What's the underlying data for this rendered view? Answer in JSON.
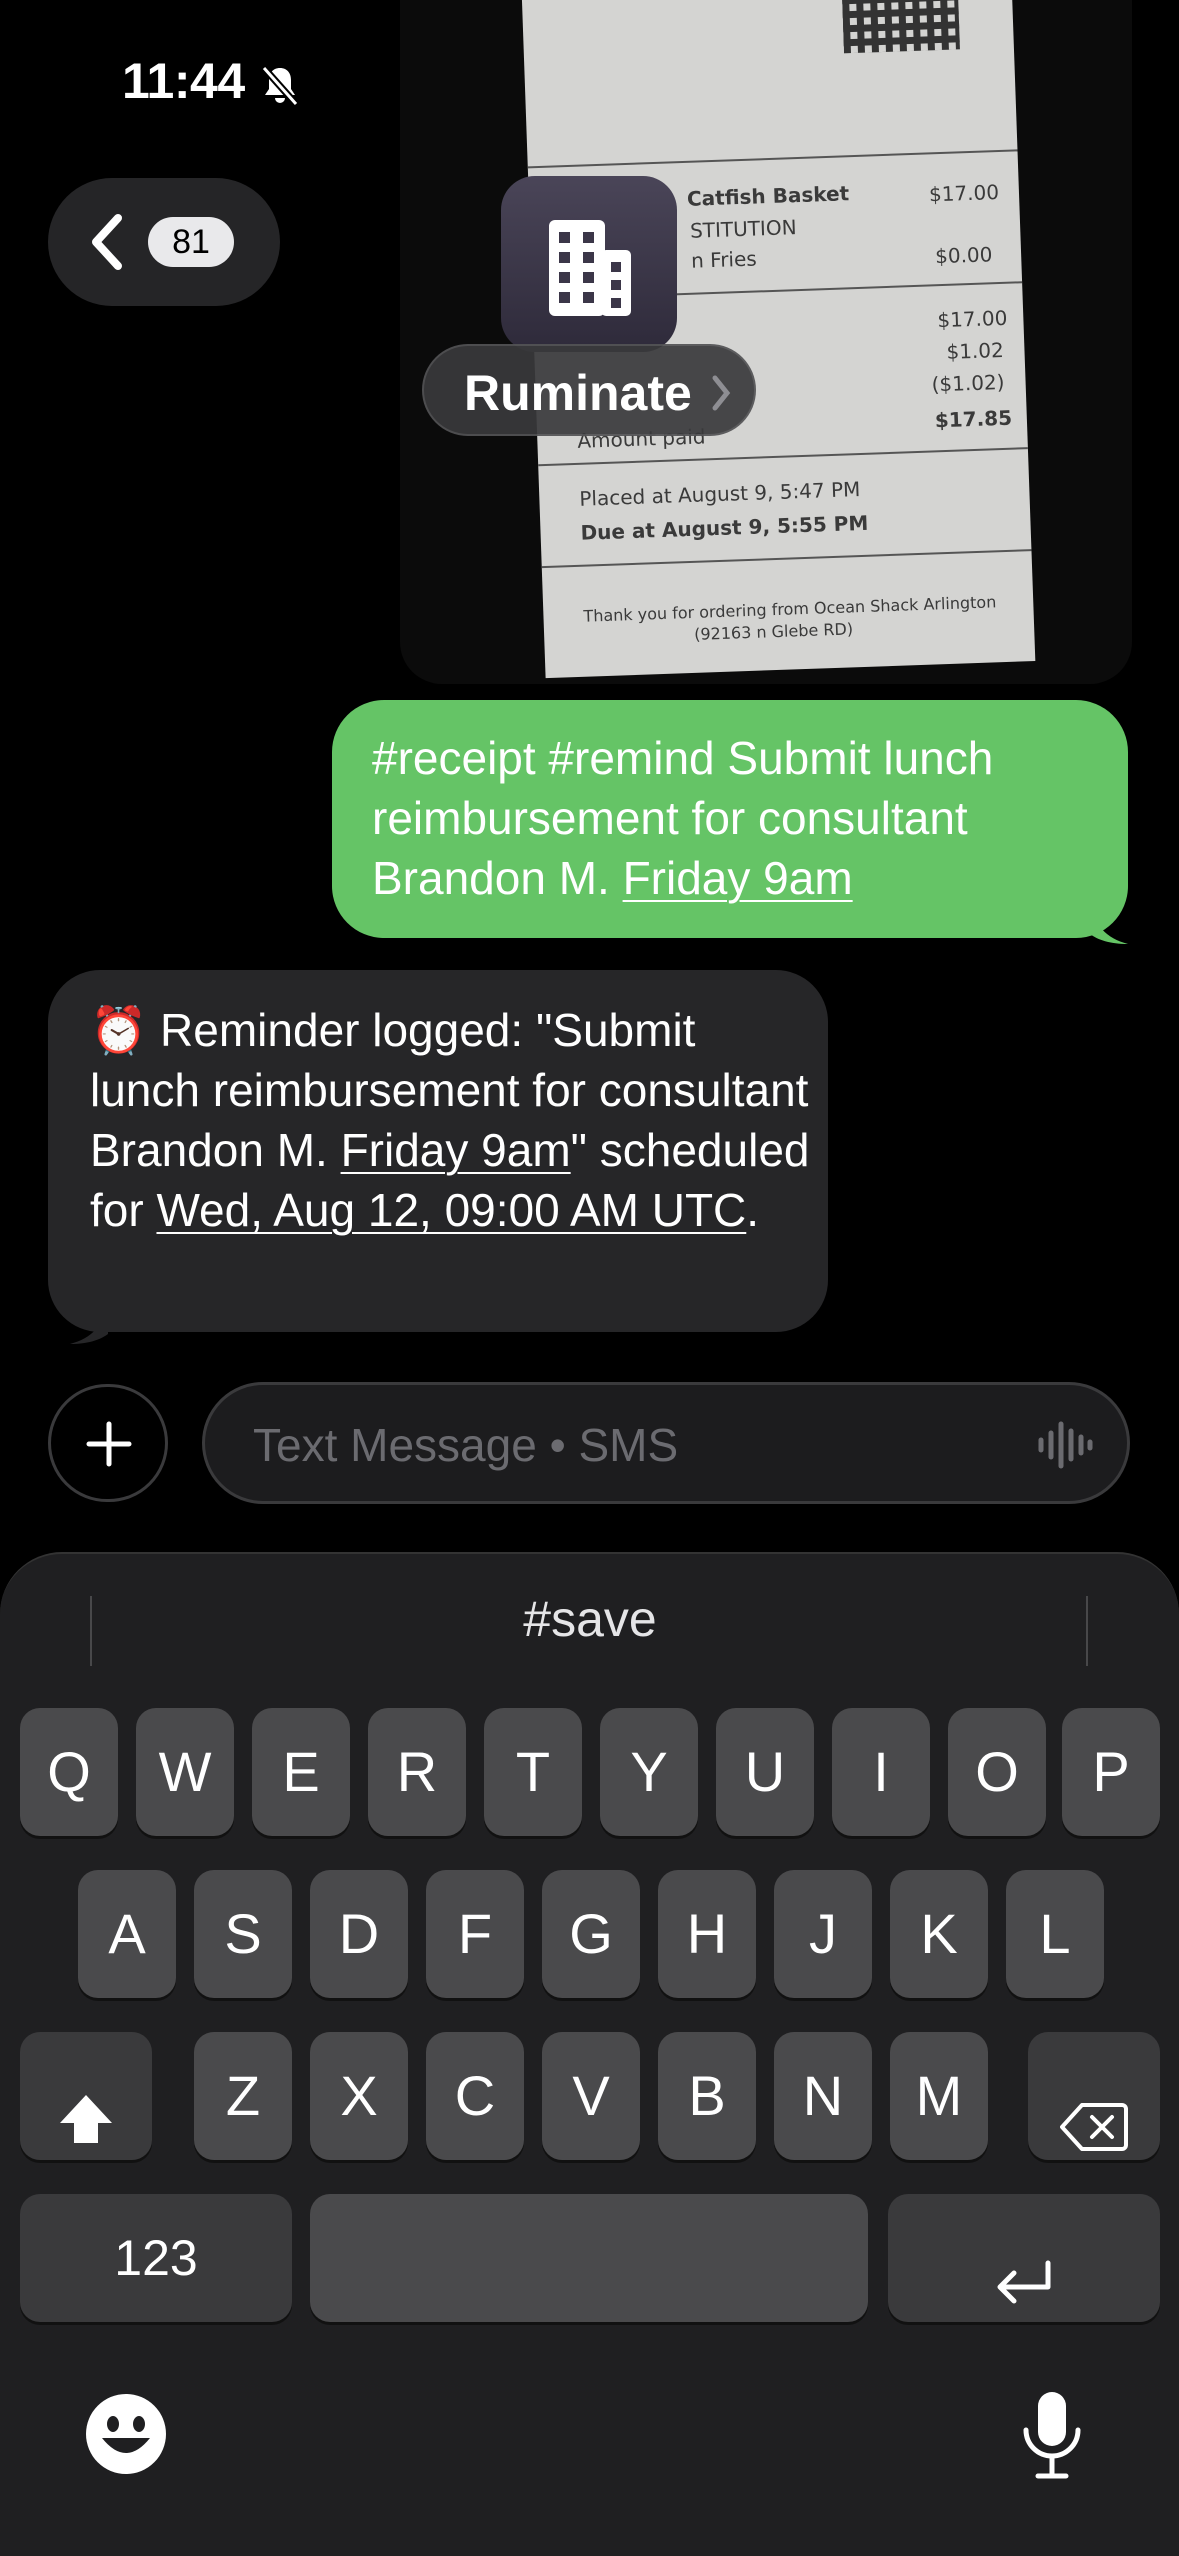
{
  "status_bar": {
    "time": "11:44"
  },
  "receipt_photo": {
    "lines": [
      {
        "left": "Catfish Basket",
        "right": "$17.00"
      },
      {
        "left": "STITUTION",
        "right": ""
      },
      {
        "left": "n Fries",
        "right": "$0.00"
      },
      {
        "left": "",
        "right": "$17.00"
      },
      {
        "left": "",
        "right": "$1.02"
      },
      {
        "left": "",
        "right": "($1.02)"
      },
      {
        "left": "Amount paid",
        "right": "$17.85"
      },
      {
        "left": "Placed at August 9, 5:47 PM",
        "right": ""
      },
      {
        "left": "Due at August 9, 5:55 PM",
        "right": ""
      },
      {
        "left": "Thank you for ordering from Ocean Shack Arlington",
        "right": ""
      },
      {
        "left": "(92163 n Glebe RD)",
        "right": ""
      }
    ]
  },
  "nav": {
    "back_count": "81"
  },
  "contact": {
    "name": "Ruminate",
    "avatar_icon": "building-icon"
  },
  "messages": {
    "sent": {
      "text_plain": "#receipt #remind Submit lunch reimbursement for consultant Brandon M. ",
      "text_link": "Friday 9am",
      "color": "#65c466"
    },
    "received": {
      "emoji": "⏰",
      "part1": " Reminder logged: \"Submit lunch reimbursement for consultant Brandon M. ",
      "link1": "Friday 9am",
      "part2": "\" scheduled for ",
      "link2": "Wed, Aug 12, 09:00 AM UTC",
      "part3": ".",
      "color": "#262628"
    }
  },
  "input": {
    "placeholder": "Text Message • SMS",
    "value": ""
  },
  "keyboard": {
    "suggestion": "#save",
    "row1": [
      "Q",
      "W",
      "E",
      "R",
      "T",
      "Y",
      "U",
      "I",
      "O",
      "P"
    ],
    "row2": [
      "A",
      "S",
      "D",
      "F",
      "G",
      "H",
      "J",
      "K",
      "L"
    ],
    "row3": [
      "Z",
      "X",
      "C",
      "V",
      "B",
      "N",
      "M"
    ],
    "numbers_label": "123"
  }
}
